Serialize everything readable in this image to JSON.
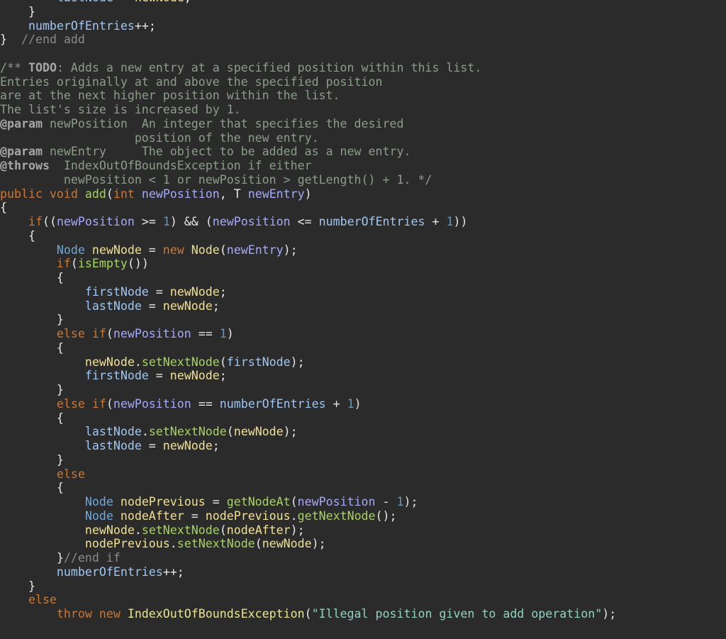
{
  "colors": {
    "background": "#2b2b2b",
    "plain": "#e6e6e6",
    "keyword": "#cc7832",
    "field": "#9ec7f5",
    "local": "#f2e18f",
    "param": "#a7a7ff",
    "number": "#6897bb",
    "method": "#a5d65a",
    "type": "#6fa8dc",
    "class": "#e8e58a",
    "string": "#8fd3c1",
    "comment": "#8a8a8a",
    "doc": "#8c9e8a"
  },
  "code_lines": [
    [
      [
        "field",
        "        lastNode"
      ],
      [
        "op",
        " = "
      ],
      [
        "local",
        "newNode"
      ],
      [
        "plain",
        ";"
      ]
    ],
    [
      [
        "plain",
        "    }"
      ]
    ],
    [
      [
        "field",
        "    numberOfEntries"
      ],
      [
        "op",
        "++"
      ],
      [
        "plain",
        ";"
      ]
    ],
    [
      [
        "plain",
        "}"
      ],
      [
        "comment",
        "  //end add"
      ]
    ],
    [
      [
        "plain",
        ""
      ]
    ],
    [
      [
        "doc",
        "/** "
      ],
      [
        "docbold",
        "TODO"
      ],
      [
        "doc",
        ": Adds a new entry at a specified position within this list."
      ]
    ],
    [
      [
        "doc",
        "Entries originally at and above the specified position"
      ]
    ],
    [
      [
        "doc",
        "are at the next higher position within the list."
      ]
    ],
    [
      [
        "doc",
        "The list's size is increased by 1."
      ]
    ],
    [
      [
        "doctag",
        "@param"
      ],
      [
        "doc",
        " newPosition  An integer that specifies the desired"
      ]
    ],
    [
      [
        "doc",
        "                   position of the new entry."
      ]
    ],
    [
      [
        "doctag",
        "@param"
      ],
      [
        "doc",
        " newEntry     The object to be added as a new entry."
      ]
    ],
    [
      [
        "doctag",
        "@throws"
      ],
      [
        "doc",
        "  IndexOutOfBoundsException if either"
      ]
    ],
    [
      [
        "doc",
        "         newPosition < 1 or newPosition > getLength() + 1. */"
      ]
    ],
    [
      [
        "kw",
        "public void "
      ],
      [
        "method",
        "add"
      ],
      [
        "plain",
        "("
      ],
      [
        "kw",
        "int "
      ],
      [
        "param",
        "newPosition"
      ],
      [
        "plain",
        ", T "
      ],
      [
        "param",
        "newEntry"
      ],
      [
        "plain",
        ")"
      ]
    ],
    [
      [
        "plain",
        "{"
      ]
    ],
    [
      [
        "kw",
        "    if"
      ],
      [
        "plain",
        "(("
      ],
      [
        "param",
        "newPosition"
      ],
      [
        "op",
        " >= "
      ],
      [
        "num",
        "1"
      ],
      [
        "plain",
        ") && ("
      ],
      [
        "param",
        "newPosition"
      ],
      [
        "op",
        " <= "
      ],
      [
        "field",
        "numberOfEntries"
      ],
      [
        "op",
        " + "
      ],
      [
        "num",
        "1"
      ],
      [
        "plain",
        "))"
      ]
    ],
    [
      [
        "plain",
        "    {"
      ]
    ],
    [
      [
        "type",
        "        Node "
      ],
      [
        "local",
        "newNode"
      ],
      [
        "op",
        " = "
      ],
      [
        "kw",
        "new "
      ],
      [
        "class",
        "Node"
      ],
      [
        "plain",
        "("
      ],
      [
        "param",
        "newEntry"
      ],
      [
        "plain",
        ");"
      ]
    ],
    [
      [
        "kw",
        "        if"
      ],
      [
        "plain",
        "("
      ],
      [
        "method",
        "isEmpty"
      ],
      [
        "plain",
        "())"
      ]
    ],
    [
      [
        "plain",
        "        {"
      ]
    ],
    [
      [
        "field",
        "            firstNode"
      ],
      [
        "op",
        " = "
      ],
      [
        "local",
        "newNode"
      ],
      [
        "plain",
        ";"
      ]
    ],
    [
      [
        "field",
        "            lastNode"
      ],
      [
        "op",
        " = "
      ],
      [
        "local",
        "newNode"
      ],
      [
        "plain",
        ";"
      ]
    ],
    [
      [
        "plain",
        "        }"
      ]
    ],
    [
      [
        "kw",
        "        else if"
      ],
      [
        "plain",
        "("
      ],
      [
        "param",
        "newPosition"
      ],
      [
        "op",
        " == "
      ],
      [
        "num",
        "1"
      ],
      [
        "plain",
        ")"
      ]
    ],
    [
      [
        "plain",
        "        {"
      ]
    ],
    [
      [
        "local",
        "            newNode"
      ],
      [
        "plain",
        "."
      ],
      [
        "method",
        "setNextNode"
      ],
      [
        "plain",
        "("
      ],
      [
        "field",
        "firstNode"
      ],
      [
        "plain",
        ");"
      ]
    ],
    [
      [
        "field",
        "            firstNode"
      ],
      [
        "op",
        " = "
      ],
      [
        "local",
        "newNode"
      ],
      [
        "plain",
        ";"
      ]
    ],
    [
      [
        "plain",
        "        }"
      ]
    ],
    [
      [
        "kw",
        "        else if"
      ],
      [
        "plain",
        "("
      ],
      [
        "param",
        "newPosition"
      ],
      [
        "op",
        " == "
      ],
      [
        "field",
        "numberOfEntries"
      ],
      [
        "op",
        " + "
      ],
      [
        "num",
        "1"
      ],
      [
        "plain",
        ")"
      ]
    ],
    [
      [
        "plain",
        "        {"
      ]
    ],
    [
      [
        "field",
        "            lastNode"
      ],
      [
        "plain",
        "."
      ],
      [
        "method",
        "setNextNode"
      ],
      [
        "plain",
        "("
      ],
      [
        "local",
        "newNode"
      ],
      [
        "plain",
        ");"
      ]
    ],
    [
      [
        "field",
        "            lastNode"
      ],
      [
        "op",
        " = "
      ],
      [
        "local",
        "newNode"
      ],
      [
        "plain",
        ";"
      ]
    ],
    [
      [
        "plain",
        "        }"
      ]
    ],
    [
      [
        "kw",
        "        else"
      ]
    ],
    [
      [
        "plain",
        "        {"
      ]
    ],
    [
      [
        "type",
        "            Node "
      ],
      [
        "local",
        "nodePrevious"
      ],
      [
        "op",
        " = "
      ],
      [
        "method",
        "getNodeAt"
      ],
      [
        "plain",
        "("
      ],
      [
        "param",
        "newPosition"
      ],
      [
        "op",
        " - "
      ],
      [
        "num",
        "1"
      ],
      [
        "plain",
        ");"
      ]
    ],
    [
      [
        "type",
        "            Node "
      ],
      [
        "local",
        "nodeAfter"
      ],
      [
        "op",
        " = "
      ],
      [
        "local",
        "nodePrevious"
      ],
      [
        "plain",
        "."
      ],
      [
        "method",
        "getNextNode"
      ],
      [
        "plain",
        "();"
      ]
    ],
    [
      [
        "local",
        "            newNode"
      ],
      [
        "plain",
        "."
      ],
      [
        "method",
        "setNextNode"
      ],
      [
        "plain",
        "("
      ],
      [
        "local",
        "nodeAfter"
      ],
      [
        "plain",
        ");"
      ]
    ],
    [
      [
        "local",
        "            nodePrevious"
      ],
      [
        "plain",
        "."
      ],
      [
        "method",
        "setNextNode"
      ],
      [
        "plain",
        "("
      ],
      [
        "local",
        "newNode"
      ],
      [
        "plain",
        ");"
      ]
    ],
    [
      [
        "plain",
        "        }"
      ],
      [
        "comment",
        "//end if"
      ]
    ],
    [
      [
        "field",
        "        numberOfEntries"
      ],
      [
        "op",
        "++"
      ],
      [
        "plain",
        ";"
      ]
    ],
    [
      [
        "plain",
        "    }"
      ]
    ],
    [
      [
        "kw",
        "    else"
      ]
    ],
    [
      [
        "kw",
        "        throw new "
      ],
      [
        "class",
        "IndexOutOfBoundsException"
      ],
      [
        "plain",
        "("
      ],
      [
        "string",
        "\"Illegal position given to add operation\""
      ],
      [
        "plain",
        ");"
      ]
    ]
  ]
}
